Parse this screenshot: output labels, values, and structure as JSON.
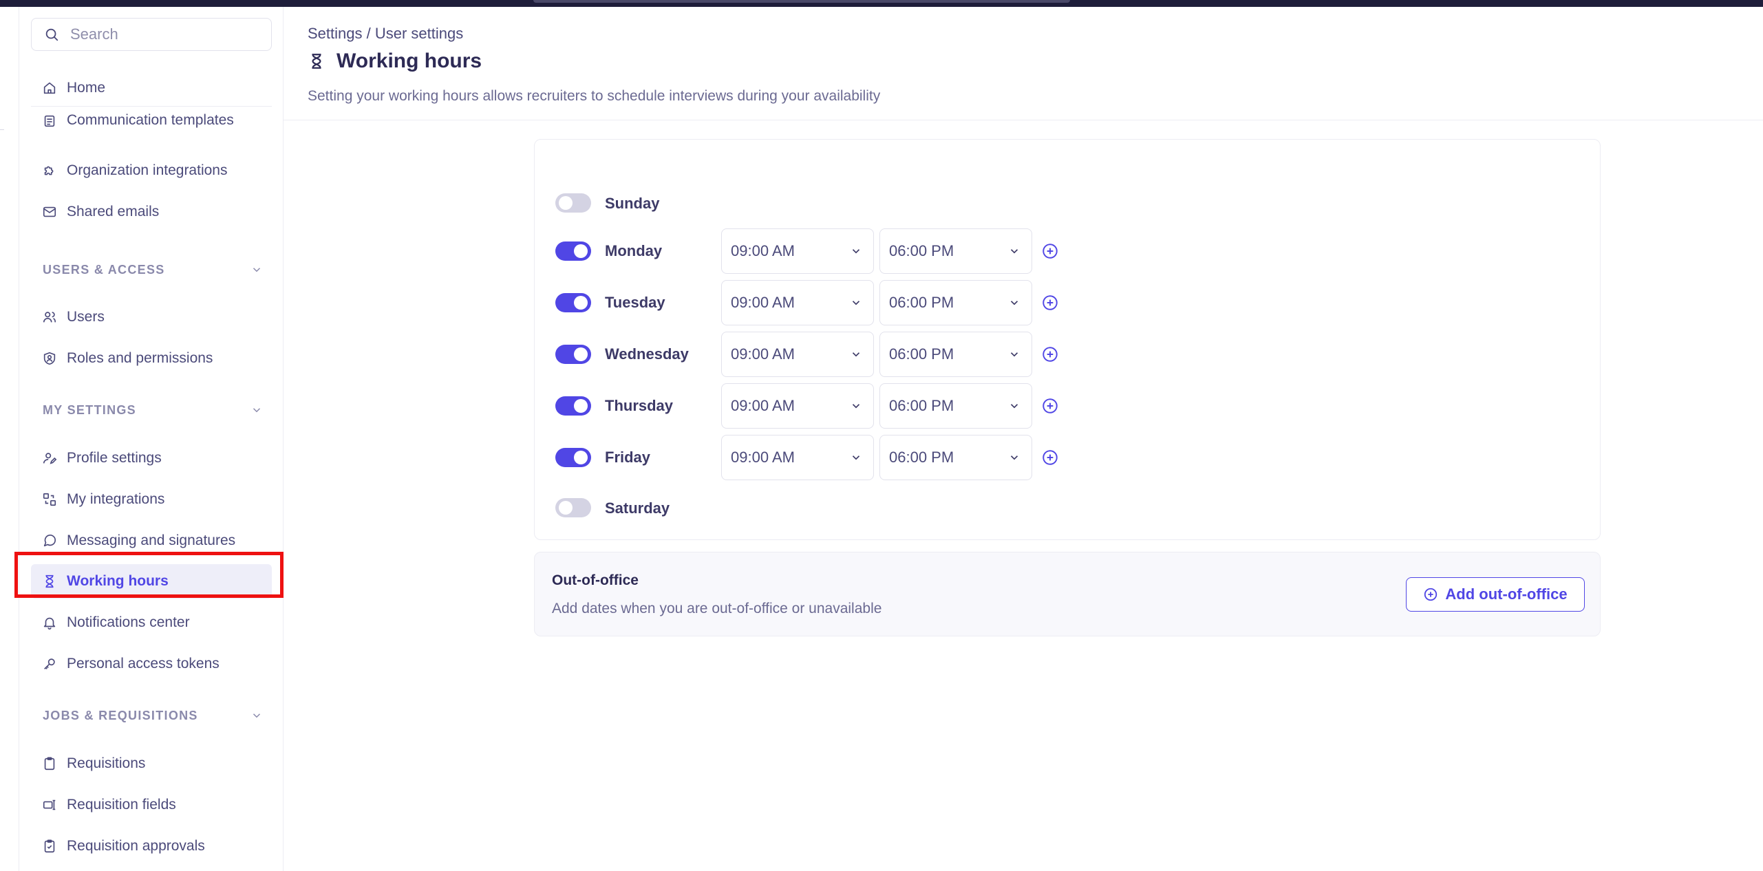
{
  "search": {
    "placeholder": "Search"
  },
  "sidebar": {
    "home": "Home",
    "general_items": [
      {
        "label": "Communication templates",
        "icon": "template-icon"
      },
      {
        "label": "Organization integrations",
        "icon": "puzzle-icon"
      },
      {
        "label": "Shared emails",
        "icon": "mail-icon"
      }
    ],
    "sections": [
      {
        "title": "USERS & ACCESS",
        "items": [
          {
            "label": "Users",
            "icon": "users-icon"
          },
          {
            "label": "Roles and permissions",
            "icon": "shield-user-icon"
          }
        ]
      },
      {
        "title": "MY SETTINGS",
        "items": [
          {
            "label": "Profile settings",
            "icon": "user-edit-icon"
          },
          {
            "label": "My integrations",
            "icon": "integrations-icon"
          },
          {
            "label": "Messaging and signatures",
            "icon": "messaging-icon"
          },
          {
            "label": "Working hours",
            "icon": "hourglass-icon",
            "active": true
          },
          {
            "label": "Notifications center",
            "icon": "bell-icon"
          },
          {
            "label": "Personal access tokens",
            "icon": "key-icon"
          }
        ]
      },
      {
        "title": "JOBS & REQUISITIONS",
        "items": [
          {
            "label": "Requisitions",
            "icon": "clipboard-icon"
          },
          {
            "label": "Requisition fields",
            "icon": "form-fields-icon"
          },
          {
            "label": "Requisition approvals",
            "icon": "clipboard-check-icon"
          }
        ]
      }
    ]
  },
  "main": {
    "breadcrumb": "Settings / User settings",
    "title": "Working hours",
    "subtitle": "Setting your working hours allows recruiters to schedule interviews during your availability",
    "days": [
      {
        "name": "Sunday",
        "enabled": false
      },
      {
        "name": "Monday",
        "enabled": true,
        "start": "09:00 AM",
        "end": "06:00 PM"
      },
      {
        "name": "Tuesday",
        "enabled": true,
        "start": "09:00 AM",
        "end": "06:00 PM"
      },
      {
        "name": "Wednesday",
        "enabled": true,
        "start": "09:00 AM",
        "end": "06:00 PM"
      },
      {
        "name": "Thursday",
        "enabled": true,
        "start": "09:00 AM",
        "end": "06:00 PM"
      },
      {
        "name": "Friday",
        "enabled": true,
        "start": "09:00 AM",
        "end": "06:00 PM"
      },
      {
        "name": "Saturday",
        "enabled": false
      }
    ],
    "out_of_office": {
      "title": "Out-of-office",
      "description": "Add dates when you are out-of-office or unavailable",
      "button": "Add out-of-office"
    }
  },
  "colors": {
    "accent": "#5046e5",
    "highlight": "#ee1111",
    "toggle_off": "#d4d3e3"
  }
}
